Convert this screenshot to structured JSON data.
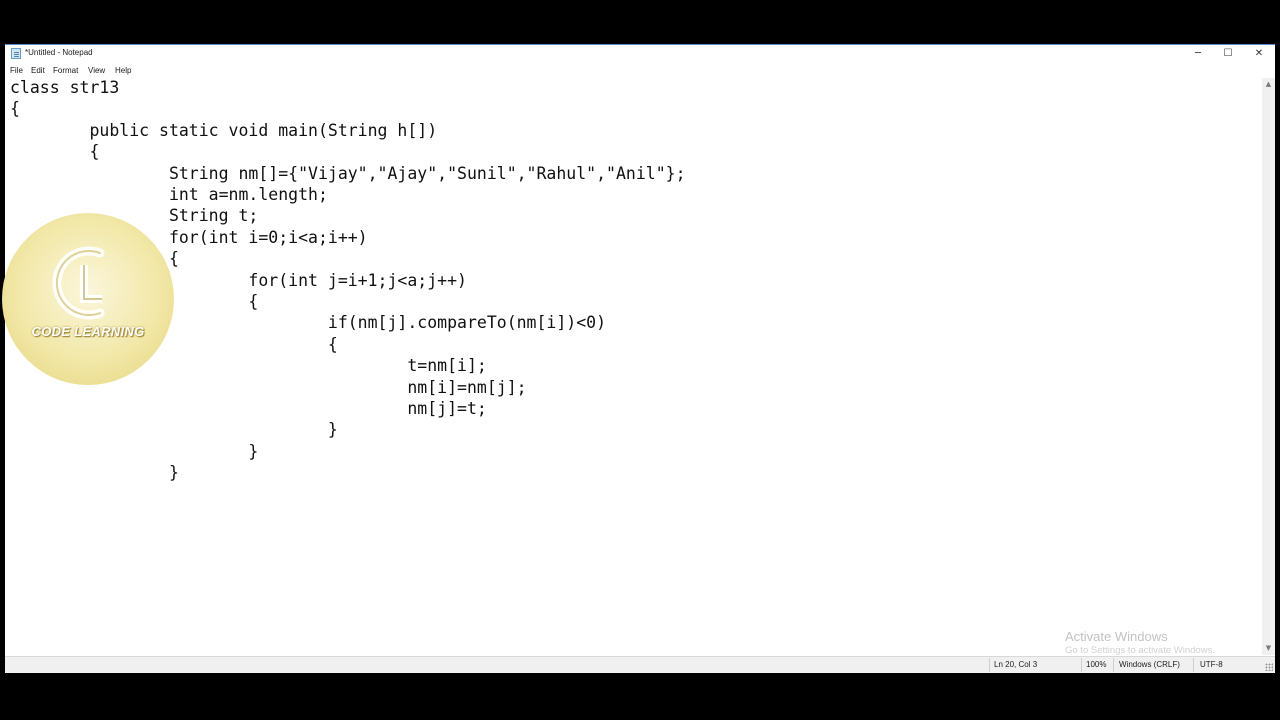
{
  "window": {
    "title": "*Untitled - Notepad",
    "controls": {
      "minimize": "─",
      "maximize": "☐",
      "close": "✕"
    }
  },
  "menu": [
    "File",
    "Edit",
    "Format",
    "View",
    "Help"
  ],
  "editor": {
    "lines": [
      "class str13",
      "{",
      "\tpublic static void main(String h[])",
      "\t{",
      "\t\tString nm[]={\"Vijay\",\"Ajay\",\"Sunil\",\"Rahul\",\"Anil\"};",
      "\t\tint a=nm.length;",
      "\t\tString t;",
      "\t\tfor(int i=0;i<a;i++)",
      "\t\t{",
      "\t\t\tfor(int j=i+1;j<a;j++)",
      "\t\t\t{",
      "\t\t\t\tif(nm[j].compareTo(nm[i])<0)",
      "\t\t\t\t{",
      "\t\t\t\t\tt=nm[i];",
      "\t\t\t\t\tnm[i]=nm[j];",
      "\t\t\t\t\tnm[j]=t;",
      "\t\t\t\t}",
      "\t\t\t}",
      "\t\t}"
    ]
  },
  "statusbar": {
    "position": "Ln 20, Col 3",
    "zoom": "100%",
    "line_ending": "Windows (CRLF)",
    "encoding": "UTF-8"
  },
  "watermark": {
    "title": "Activate Windows",
    "subtitle": "Go to Settings to activate Windows."
  },
  "logo": {
    "text": "CODE LEARNING"
  },
  "colors": {
    "window_border": "#5b8fd4",
    "background": "#000000",
    "logo_gold": "#f2e8a8"
  }
}
